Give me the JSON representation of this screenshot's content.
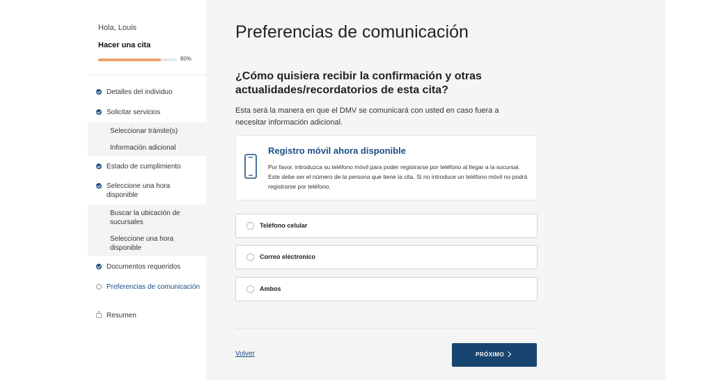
{
  "sidebar": {
    "greeting": "Hola, Louis",
    "task": "Hacer una cita",
    "progress_label": "80%",
    "progress_fraction": 0.8,
    "steps": [
      {
        "label": "Detalles del individuo",
        "state": "done"
      },
      {
        "label": "Solicitar servicios",
        "state": "done"
      },
      {
        "label": "Seleccionar trámite(s)",
        "state": "sub"
      },
      {
        "label": "Información adicional",
        "state": "sub"
      },
      {
        "label": "Estado de cumplimiento",
        "state": "done"
      },
      {
        "label": "Seleccione una hora disponible",
        "state": "done"
      },
      {
        "label": "Buscar la ubicación de sucursales",
        "state": "sub"
      },
      {
        "label": "Seleccione una hora disponible",
        "state": "sub"
      },
      {
        "label": "Documentos requeridos",
        "state": "done"
      },
      {
        "label": "Preferencias de comunicación",
        "state": "current"
      },
      {
        "label": "Resumen",
        "state": "locked"
      }
    ]
  },
  "main": {
    "title": "Preferencias de comunicación",
    "question": "¿Cómo quisiera recibir la confirmación y otras actualidades/recordatorios de esta cita?",
    "help": "Esta será la manera en que el DMV se comunicará con usted en caso fuera a necesitar información adicional.",
    "notice": {
      "icon": "mobile-phone-icon",
      "title": "Registro móvil ahora disponible",
      "body": "Por favor, introduzca su teléfono móvil para poder registrarse por teléfono al llegar a la sucursal. Este debe ser el número de la persona que tiene la cita. Si no introduce un teléfono móvil no podrá registrarse por teléfono."
    },
    "options": [
      {
        "label": "Teléfono celular",
        "selected": false
      },
      {
        "label": "Correo eléctronico",
        "selected": false
      },
      {
        "label": "Ambos",
        "selected": false
      }
    ],
    "back_label": "Volver",
    "next_label": "PRÓXIMO"
  },
  "colors": {
    "accent": "#1b4f86",
    "button": "#18456f",
    "progress": "#f0a16a",
    "main_bg": "#f5f5f5"
  }
}
